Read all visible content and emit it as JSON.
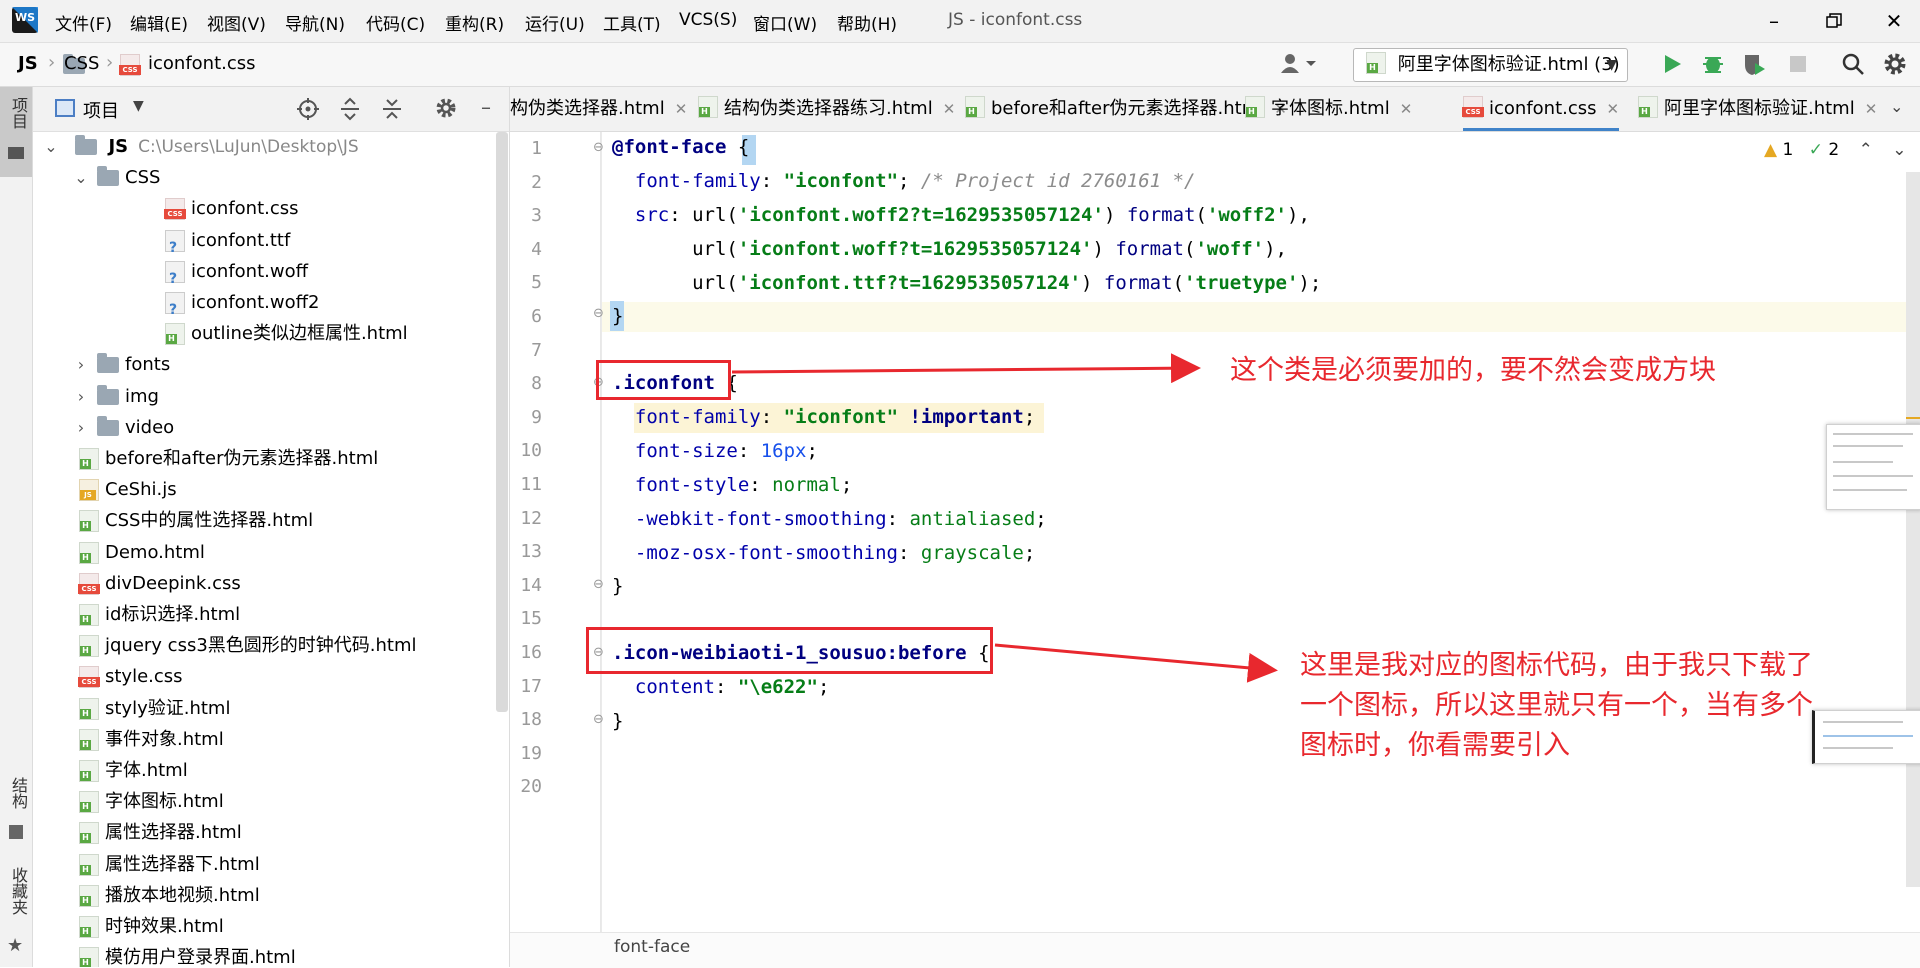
{
  "app": {
    "logo_text": "WS",
    "window_title": "JS - iconfont.css"
  },
  "menu": [
    "文件(F)",
    "编辑(E)",
    "视图(V)",
    "导航(N)",
    "代码(C)",
    "重构(R)",
    "运行(U)",
    "工具(T)",
    "VCS(S)",
    "窗口(W)",
    "帮助(H)"
  ],
  "breadcrumb": [
    "JS",
    "CSS",
    "iconfont.css"
  ],
  "run_config": "阿里字体图标验证.html (3)",
  "left_strip": {
    "project_label": "项目",
    "structure_label": "结构",
    "favorites_label": "收藏夹"
  },
  "project_panel": {
    "title": "项目",
    "root_name": "JS",
    "root_path": "C:\\Users\\LuJun\\Desktop\\JS",
    "items": [
      {
        "name": "CSS",
        "type": "folder",
        "level": 1,
        "expanded": true
      },
      {
        "name": "iconfont.css",
        "type": "css",
        "level": 2
      },
      {
        "name": "iconfont.ttf",
        "type": "unknown",
        "level": 2
      },
      {
        "name": "iconfont.woff",
        "type": "unknown",
        "level": 2
      },
      {
        "name": "iconfont.woff2",
        "type": "unknown",
        "level": 2
      },
      {
        "name": "outline类似边框属性.html",
        "type": "html",
        "level": 2
      },
      {
        "name": "fonts",
        "type": "folder",
        "level": 1,
        "expanded": false
      },
      {
        "name": "img",
        "type": "folder",
        "level": 1,
        "expanded": false
      },
      {
        "name": "video",
        "type": "folder",
        "level": 1,
        "expanded": false
      },
      {
        "name": "before和after伪元素选择器.html",
        "type": "html",
        "level": 1
      },
      {
        "name": "CeShi.js",
        "type": "js",
        "level": 1
      },
      {
        "name": "CSS中的属性选择器.html",
        "type": "html",
        "level": 1
      },
      {
        "name": "Demo.html",
        "type": "html",
        "level": 1
      },
      {
        "name": "divDeepink.css",
        "type": "css",
        "level": 1
      },
      {
        "name": "id标识选择.html",
        "type": "html",
        "level": 1
      },
      {
        "name": "jquery css3黑色圆形的时钟代码.html",
        "type": "html",
        "level": 1
      },
      {
        "name": "style.css",
        "type": "css",
        "level": 1
      },
      {
        "name": "styly验证.html",
        "type": "html",
        "level": 1
      },
      {
        "name": "事件对象.html",
        "type": "html",
        "level": 1
      },
      {
        "name": "字体.html",
        "type": "html",
        "level": 1
      },
      {
        "name": "字体图标.html",
        "type": "html",
        "level": 1
      },
      {
        "name": "属性选择器.html",
        "type": "html",
        "level": 1
      },
      {
        "name": "属性选择器下.html",
        "type": "html",
        "level": 1
      },
      {
        "name": "播放本地视频.html",
        "type": "html",
        "level": 1
      },
      {
        "name": "时钟效果.html",
        "type": "html",
        "level": 1
      },
      {
        "name": "模仿用户登录界面.html",
        "type": "html",
        "level": 1
      }
    ]
  },
  "tabs": [
    {
      "label": "构伪类选择器.html",
      "type": "html",
      "active": false
    },
    {
      "label": "结构伪类选择器练习.html",
      "type": "html",
      "active": false
    },
    {
      "label": "before和after伪元素选择器.html",
      "type": "html",
      "active": false
    },
    {
      "label": "字体图标.html",
      "type": "html",
      "active": false
    },
    {
      "label": "iconfont.css",
      "type": "css",
      "active": true
    },
    {
      "label": "阿里字体图标验证.html",
      "type": "html",
      "active": false
    }
  ],
  "inspections": {
    "warnings": "1",
    "checks": "2"
  },
  "line_numbers": [
    "1",
    "2",
    "3",
    "4",
    "5",
    "6",
    "7",
    "8",
    "9",
    "10",
    "11",
    "12",
    "13",
    "14",
    "15",
    "16",
    "17",
    "18",
    "19",
    "20"
  ],
  "code": {
    "l1_at": "@font-face",
    "l1_brace": " {",
    "l2_prop": "font-family",
    "l2_val": "\"iconfont\"",
    "l2_comment": "/* Project id 2760161 */",
    "l3_prop": "src",
    "l3_url": "'iconfont.woff2?t=1629535057124'",
    "l3_fmt": "'woff2'",
    "l4_url": "'iconfont.woff?t=1629535057124'",
    "l4_fmt": "'woff'",
    "l5_url": "'iconfont.ttf?t=1629535057124'",
    "l5_fmt": "'truetype'",
    "l6": "}",
    "l8_sel": ".iconfont",
    "l8_brace": " {",
    "l9_prop": "font-family",
    "l9_val": "\"iconfont\"",
    "l9_imp": "!important",
    "l10_prop": "font-size",
    "l10_val": "16px",
    "l11_prop": "font-style",
    "l11_val": "normal",
    "l12_prop": "-webkit-font-smoothing",
    "l12_val": "antialiased",
    "l13_prop": "-moz-osx-font-smoothing",
    "l13_val": "grayscale",
    "l14": "}",
    "l16_sel": ".icon-weibiaoti-1_sousuo",
    "l16_pseudo": ":before",
    "l16_brace": " {",
    "l17_prop": "content",
    "l17_val": "\"\\e622\"",
    "l18": "}",
    "url_kw": "url",
    "format_kw": "format"
  },
  "annotations": {
    "note1": "这个类是必须要加的，要不然会变成方块",
    "note2_line1": "这里是我对应的图标代码，由于我只下载了",
    "note2_line2": "一个图标，所以这里就只有一个，当有多个",
    "note2_line3": "图标时，你看需要引入"
  },
  "status_breadcrumb": "font-face",
  "colors": {
    "accent": "#4083c9",
    "annotation_red": "#e8282e",
    "run_green": "#3aa856"
  }
}
